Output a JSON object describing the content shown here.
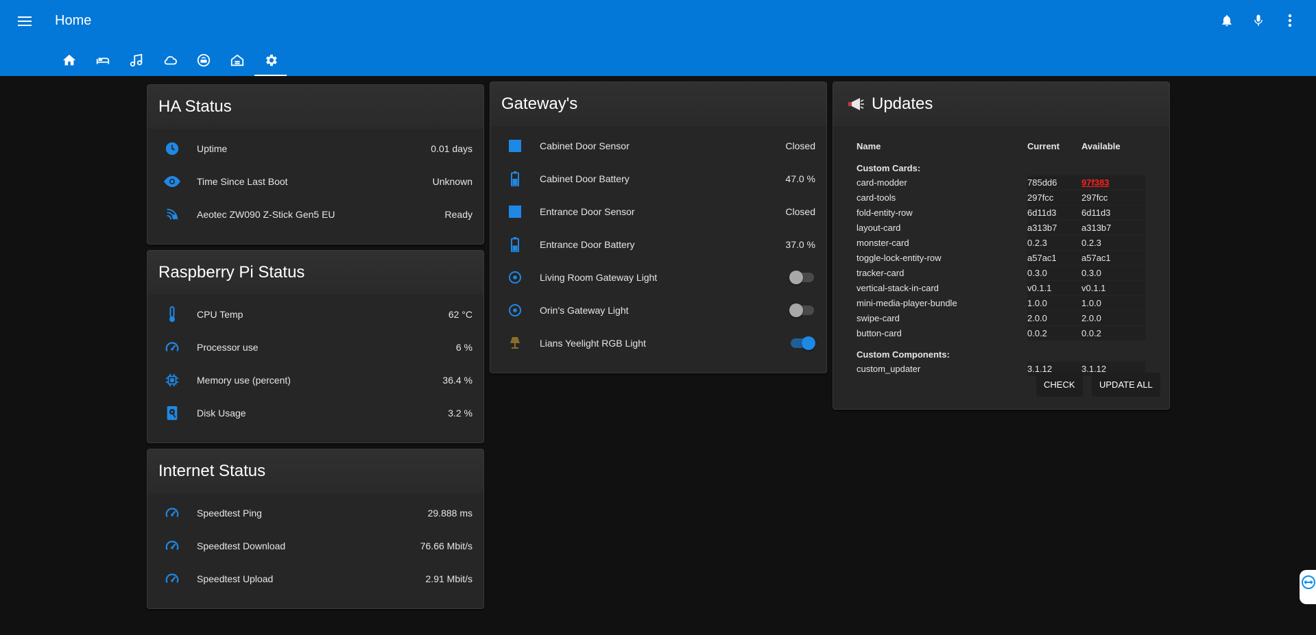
{
  "header": {
    "title": "Home"
  },
  "top_actions": [
    "notifications-icon",
    "microphone-icon",
    "overflow-menu-icon"
  ],
  "tabs": [
    "home-icon",
    "bed-icon",
    "music-icon",
    "cloud-icon",
    "router-icon",
    "home-garage-icon",
    "settings-icon"
  ],
  "colors": {
    "accent": "#0378d8",
    "icon_blue": "#1e88e5",
    "background": "#111111",
    "card": "#262626",
    "lamp_off": "#8a6d2b",
    "update_available": "#ff2020"
  },
  "ha_status": {
    "title": "HA Status",
    "rows": [
      {
        "icon": "clock-icon",
        "name": "Uptime",
        "value": "0.01 days"
      },
      {
        "icon": "eye-icon",
        "name": "Time Since Last Boot",
        "value": "Unknown"
      },
      {
        "icon": "zwave-icon",
        "name": "Aeotec ZW090 Z-Stick Gen5 EU",
        "value": "Ready"
      }
    ]
  },
  "pi_status": {
    "title": "Raspberry Pi Status",
    "rows": [
      {
        "icon": "thermometer-icon",
        "name": "CPU Temp",
        "value": "62 °C"
      },
      {
        "icon": "speedometer-icon",
        "name": "Processor use",
        "value": "6 %"
      },
      {
        "icon": "chip-icon",
        "name": "Memory use (percent)",
        "value": "36.4 %"
      },
      {
        "icon": "harddisk-icon",
        "name": "Disk Usage",
        "value": "3.2 %"
      }
    ]
  },
  "internet_status": {
    "title": "Internet Status",
    "rows": [
      {
        "icon": "speedometer-icon",
        "name": "Speedtest Ping",
        "value": "29.888 ms"
      },
      {
        "icon": "speedometer-icon",
        "name": "Speedtest Download",
        "value": "76.66 Mbit/s"
      },
      {
        "icon": "speedometer-icon",
        "name": "Speedtest Upload",
        "value": "2.91 Mbit/s"
      }
    ]
  },
  "gateways": {
    "title": "Gateway's",
    "rows": [
      {
        "icon": "square-icon",
        "name": "Cabinet Door Sensor",
        "value": "Closed"
      },
      {
        "icon": "battery-icon",
        "name": "Cabinet Door Battery",
        "value": "47.0 %"
      },
      {
        "icon": "square-icon",
        "name": "Entrance Door Sensor",
        "value": "Closed"
      },
      {
        "icon": "battery-icon",
        "name": "Entrance Door Battery",
        "value": "37.0 %"
      },
      {
        "icon": "circle-dot-icon",
        "name": "Living Room Gateway Light",
        "toggle": "off"
      },
      {
        "icon": "circle-dot-icon",
        "name": "Orin's Gateway Light",
        "toggle": "off"
      },
      {
        "icon": "lamp-icon",
        "name": "Lians Yeelight RGB Light",
        "toggle": "on"
      }
    ]
  },
  "updates": {
    "icon": "megaphone-icon",
    "title": "Updates",
    "col_name": "Name",
    "col_current": "Current",
    "col_available": "Available",
    "cards_heading": "Custom Cards:",
    "cards": [
      {
        "name": "card-modder",
        "current": "785dd6",
        "available": "97f383",
        "update": true
      },
      {
        "name": "card-tools",
        "current": "297fcc",
        "available": "297fcc"
      },
      {
        "name": "fold-entity-row",
        "current": "6d11d3",
        "available": "6d11d3"
      },
      {
        "name": "layout-card",
        "current": "a313b7",
        "available": "a313b7"
      },
      {
        "name": "monster-card",
        "current": "0.2.3",
        "available": "0.2.3"
      },
      {
        "name": "toggle-lock-entity-row",
        "current": "a57ac1",
        "available": "a57ac1"
      },
      {
        "name": "tracker-card",
        "current": "0.3.0",
        "available": "0.3.0"
      },
      {
        "name": "vertical-stack-in-card",
        "current": "v0.1.1",
        "available": "v0.1.1"
      },
      {
        "name": "mini-media-player-bundle",
        "current": "1.0.0",
        "available": "1.0.0"
      },
      {
        "name": "swipe-card",
        "current": "2.0.0",
        "available": "2.0.0"
      },
      {
        "name": "button-card",
        "current": "0.0.2",
        "available": "0.0.2"
      }
    ],
    "components_heading": "Custom Components:",
    "components": [
      {
        "name": "custom_updater",
        "current": "3.1.12",
        "available": "3.1.12"
      }
    ],
    "check_label": "CHECK",
    "update_all_label": "UPDATE ALL"
  }
}
